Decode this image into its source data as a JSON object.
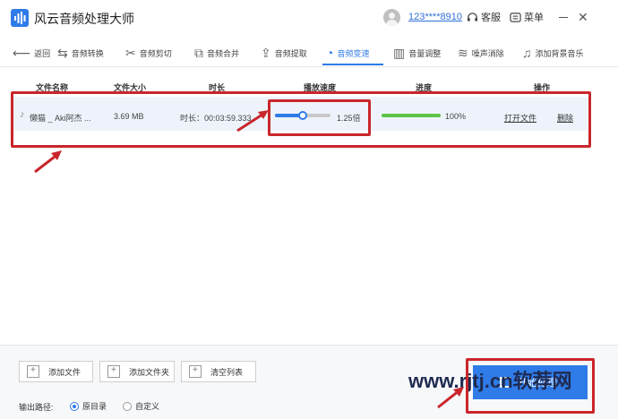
{
  "app": {
    "title": "风云音频处理大师"
  },
  "account": {
    "user_id": "123****8910",
    "support_label": "客服",
    "menu_label": "菜单"
  },
  "toolbar": {
    "back": "返回",
    "items": [
      {
        "label": "音频转换",
        "icon": "convert-icon"
      },
      {
        "label": "音频剪切",
        "icon": "scissors-icon"
      },
      {
        "label": "音频合并",
        "icon": "merge-icon"
      },
      {
        "label": "音频提取",
        "icon": "extract-icon"
      },
      {
        "label": "音频变速",
        "icon": "speed-icon",
        "active": true
      },
      {
        "label": "音量调整",
        "icon": "volume-bars-icon"
      },
      {
        "label": "噪声消除",
        "icon": "noise-icon"
      },
      {
        "label": "添加背景音乐",
        "icon": "music-note-icon"
      }
    ]
  },
  "table": {
    "headers": [
      "文件名称",
      "文件大小",
      "时长",
      "播放速度",
      "进度",
      "操作"
    ],
    "rows": [
      {
        "name": "懒猫 _ Aki阿杰 ...",
        "size": "3.69 MB",
        "duration": "时长：00:03:59.333",
        "speed_label": "1.25倍",
        "speed_fraction": 0.5,
        "progress_label": "100%",
        "progress_fraction": 1.0,
        "open_label": "打开文件",
        "delete_label": "删除"
      }
    ]
  },
  "bottom": {
    "add_file": "添加文件",
    "add_folder": "添加文件夹",
    "clear_list": "清空列表",
    "output_label": "输出路径:",
    "option_original": "原目录",
    "option_custom": "自定义",
    "start_label": "开始处理"
  },
  "watermark": "www.rjtj.cn软荐网",
  "colors": {
    "accent": "#2f7be8",
    "annotation": "#c9262c",
    "progress": "#5cc446"
  }
}
